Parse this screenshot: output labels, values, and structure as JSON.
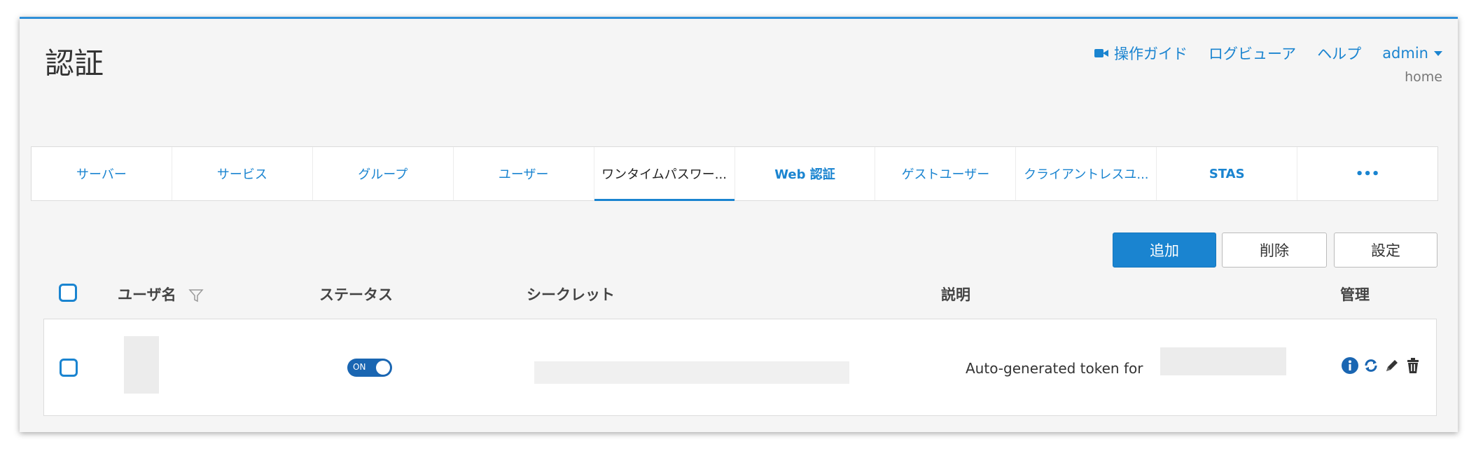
{
  "page": {
    "title": "認証"
  },
  "header": {
    "guide_label": "操作ガイド",
    "log_viewer_label": "ログビューア",
    "help_label": "ヘルプ",
    "user_label": "admin",
    "user_sub": "home"
  },
  "tabs": [
    {
      "label": "サーバー"
    },
    {
      "label": "サービス"
    },
    {
      "label": "グループ"
    },
    {
      "label": "ユーザー"
    },
    {
      "label": "ワンタイムパスワー..."
    },
    {
      "label": "Web 認証"
    },
    {
      "label": "ゲストユーザー"
    },
    {
      "label": "クライアントレスユ..."
    },
    {
      "label": "STAS"
    },
    {
      "label": "•••"
    }
  ],
  "active_tab": "ワンタイムパスワー...",
  "toolbar": {
    "add_label": "追加",
    "delete_label": "削除",
    "settings_label": "設定"
  },
  "table": {
    "columns": [
      "ユーザ名",
      "ステータス",
      "シークレット",
      "説明",
      "管理"
    ],
    "rows": [
      {
        "status": "ON",
        "description": "Auto-generated token for"
      }
    ]
  },
  "colors": {
    "accent": "#1a84d0",
    "toggle_on": "#1a66b2"
  },
  "icons": [
    "video-icon",
    "chevron-down-icon",
    "filter-icon",
    "info-icon",
    "refresh-icon",
    "pencil-icon",
    "trash-icon"
  ]
}
